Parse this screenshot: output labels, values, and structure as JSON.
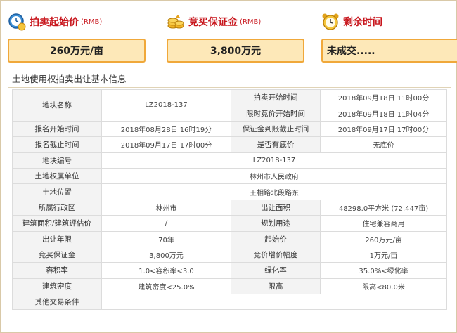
{
  "stats": {
    "start_price": {
      "label": "拍卖起始价",
      "unit": "(RMB)",
      "value": "260万元/亩",
      "icon": "clock-coin-icon"
    },
    "deposit": {
      "label": "竞买保证金",
      "unit": "(RMB)",
      "value": "3,800万元",
      "icon": "coin-stack-icon"
    },
    "remaining": {
      "label": "剩余时间",
      "value": "未成交.....",
      "icon": "alarm-clock-icon"
    }
  },
  "section": {
    "title": "土地使用权拍卖出让基本信息"
  },
  "table": {
    "parcel_name_label": "地块名称",
    "parcel_name_value": "LZ2018-137",
    "auction_start_label": "拍卖开始时间",
    "auction_start_value": "2018年09月18日 11时00分",
    "bid_start_label": "限时竞价开始时间",
    "bid_start_value": "2018年09月18日 11时04分",
    "reg_start_label": "报名开始时间",
    "reg_start_value": "2018年08月28日 16时19分",
    "deposit_deadline_label": "保证金到账截止时间",
    "deposit_deadline_value": "2018年09月17日 17时00分",
    "reg_end_label": "报名截止时间",
    "reg_end_value": "2018年09月17日 17时00分",
    "reserve_label": "是否有底价",
    "reserve_value": "无底价",
    "parcel_no_label": "地块编号",
    "parcel_no_value": "LZ2018-137",
    "owner_label": "土地权属单位",
    "owner_value": "林州市人民政府",
    "location_label": "土地位置",
    "location_value": "王相路北段路东",
    "district_label": "所属行政区",
    "district_value": "林州市",
    "area_label": "出让面积",
    "area_value": "48298.0平方米 (72.447亩)",
    "build_area_label": "建筑面积/建筑评估价",
    "build_area_value": "/",
    "plan_use_label": "规划用途",
    "plan_use_value": "住宅兼容商用",
    "term_label": "出让年限",
    "term_value": "70年",
    "start_price_label": "起始价",
    "start_price_value": "260万元/亩",
    "deposit_label": "竞买保证金",
    "deposit_value": "3,800万元",
    "increment_label": "竞价增价幅度",
    "increment_value": "1万元/亩",
    "far_label": "容积率",
    "far_value": "1.0<容积率<3.0",
    "green_label": "绿化率",
    "green_value": "35.0%<绿化率",
    "density_label": "建筑密度",
    "density_value": "建筑密度<25.0%",
    "height_label": "限高",
    "height_value": "限高<80.0米",
    "other_label": "其他交易条件",
    "other_value": ""
  }
}
